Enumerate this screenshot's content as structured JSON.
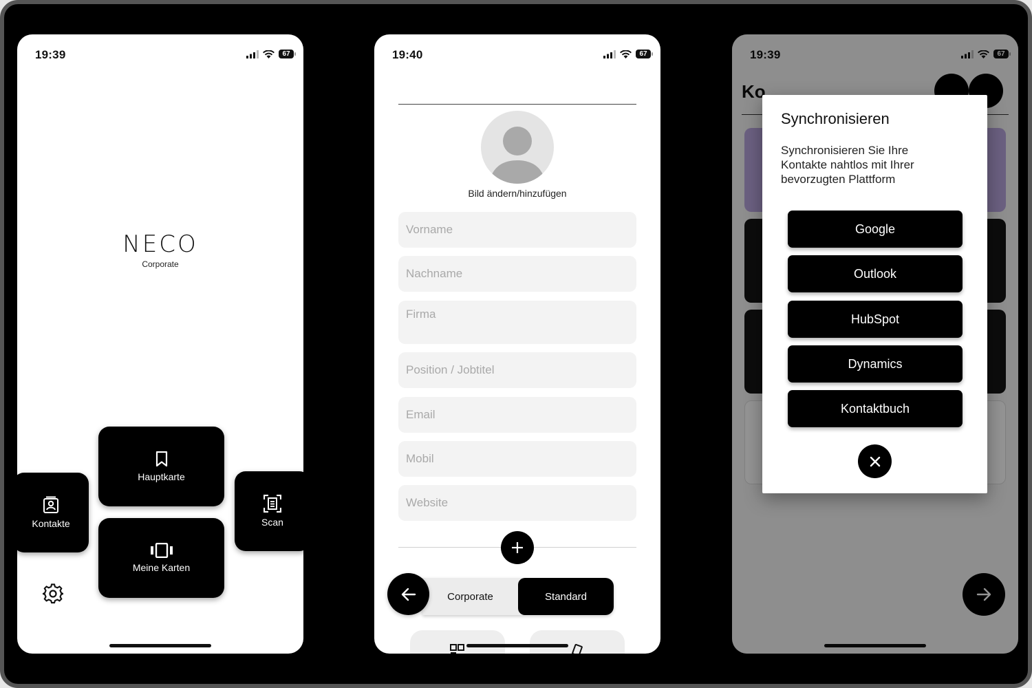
{
  "status_bar": {
    "phone1_time": "19:39",
    "phone2_time": "19:40",
    "phone3_time": "19:39",
    "battery": "67"
  },
  "home": {
    "logo_text": "NECO",
    "logo_subtitle": "Corporate",
    "tiles": {
      "kontakte": "Kontakte",
      "hauptkarte": "Hauptkarte",
      "meine_karten": "Meine Karten",
      "scan": "Scan"
    },
    "icons": [
      "contacts-icon",
      "bookmark-icon",
      "cards-carousel-icon",
      "scan-icon",
      "gear-icon"
    ]
  },
  "form": {
    "avatar_caption": "Bild ändern/hinzufügen",
    "fields": {
      "vorname": "Vorname",
      "nachname": "Nachname",
      "firma": "Firma",
      "position": "Position / Jobtitel",
      "email": "Email",
      "mobil": "Mobil",
      "website": "Website"
    },
    "segment": {
      "corporate": "Corporate",
      "standard": "Standard",
      "active": "Standard"
    }
  },
  "contacts_screen": {
    "title_fragment": "Ko",
    "dialog": {
      "title": "Synchronisieren",
      "text": "Synchronisieren Sie Ihre Kontakte nahtlos mit Ihrer bevorzugten Plattform",
      "buttons": [
        "Google",
        "Outlook",
        "HubSpot",
        "Dynamics",
        "Kontaktbuch"
      ]
    }
  },
  "colors": {
    "primary": "#000000",
    "field_bg": "#f3f3f3",
    "placeholder": "#a9a9a9",
    "card_purple": "#b8a5de"
  }
}
